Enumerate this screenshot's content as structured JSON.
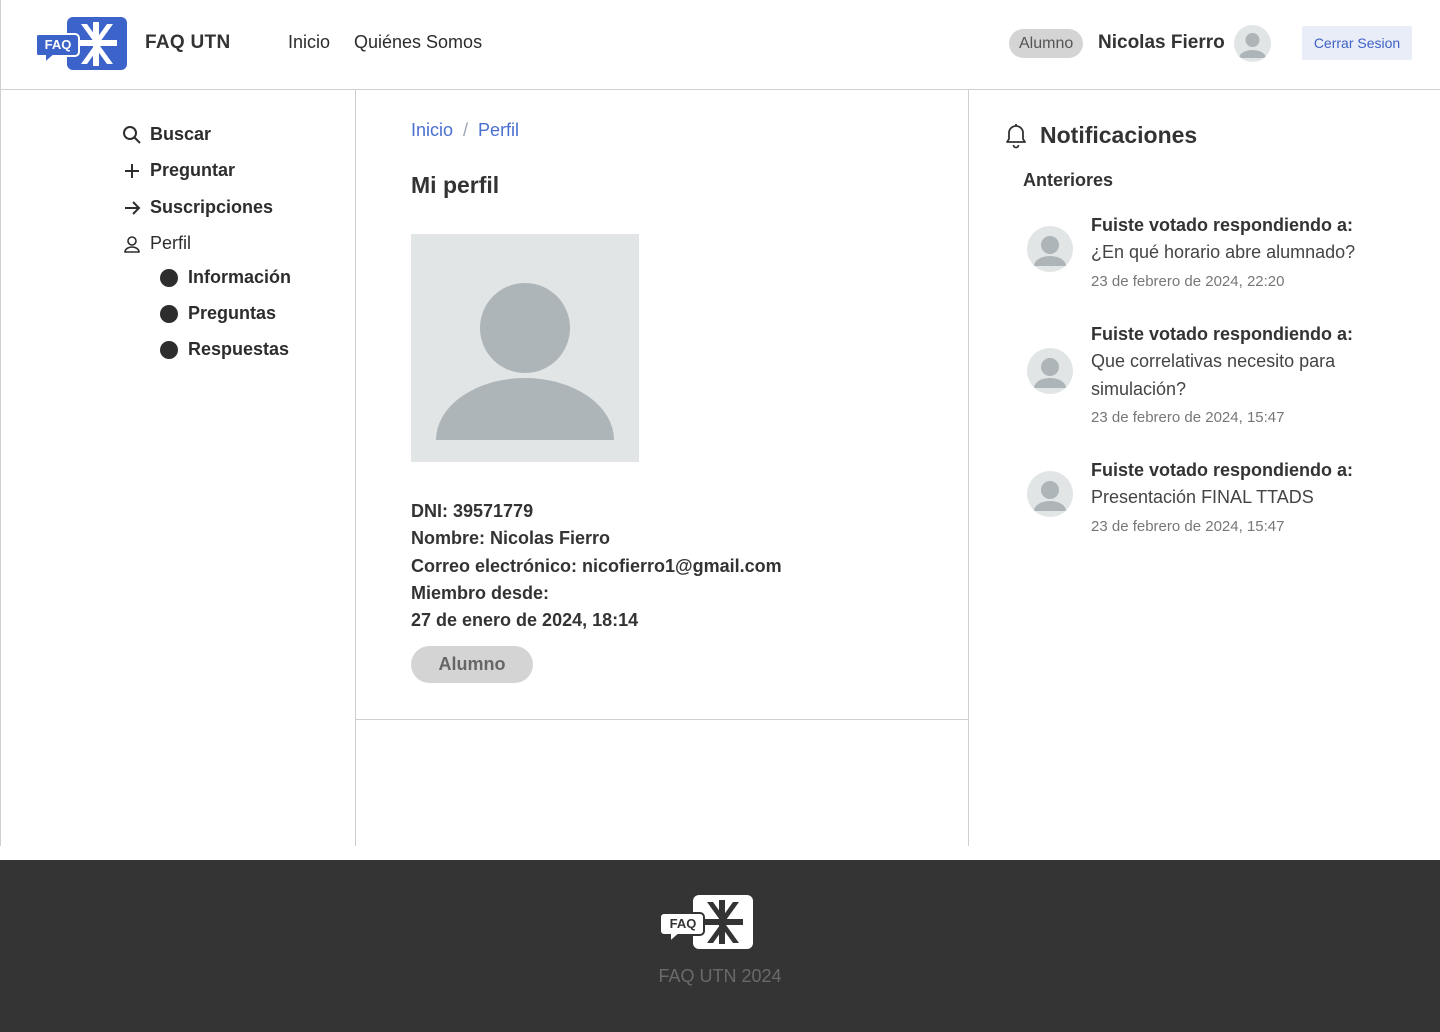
{
  "header": {
    "logo_text": "FAQ",
    "brand": "FAQ UTN",
    "nav": [
      "Inicio",
      "Quiénes Somos"
    ],
    "role": "Alumno",
    "user_name": "Nicolas Fierro",
    "logout_label": "Cerrar Sesion"
  },
  "sidebar": {
    "items": [
      {
        "label": "Buscar",
        "icon": "search-icon"
      },
      {
        "label": "Preguntar",
        "icon": "plus-icon"
      },
      {
        "label": "Suscripciones",
        "icon": "arrow-right-icon"
      },
      {
        "label": "Perfil",
        "icon": "user-icon"
      }
    ],
    "subitems": [
      "Información",
      "Preguntas",
      "Respuestas"
    ]
  },
  "main": {
    "breadcrumb": [
      "Inicio",
      "Perfil"
    ],
    "breadcrumb_sep": "/",
    "title": "Mi perfil",
    "info": {
      "dni": "DNI: 39571779",
      "nombre": "Nombre: Nicolas Fierro",
      "correo": "Correo electrónico: nicofierro1@gmail.com",
      "miembro_label": "Miembro desde:",
      "miembro_fecha": "27 de enero de 2024, 18:14"
    },
    "role_badge": "Alumno"
  },
  "notifications": {
    "title": "Notificaciones",
    "section": "Anteriores",
    "items": [
      {
        "title": "Fuiste votado respondiendo a:",
        "text": "¿En qué horario abre alumnado?",
        "date": "23 de febrero de 2024, 22:20"
      },
      {
        "title": "Fuiste votado respondiendo a:",
        "text": "Que correlativas necesito para simulación?",
        "date": "23 de febrero de 2024, 15:47"
      },
      {
        "title": "Fuiste votado respondiendo a:",
        "text": "Presentación FINAL TTADS",
        "date": "23 de febrero de 2024, 15:47"
      }
    ]
  },
  "footer": {
    "logo_text": "FAQ",
    "text": "FAQ UTN 2024"
  },
  "colors": {
    "accent": "#3f62c6",
    "link": "#4a6fd0",
    "footer_bg": "#343434",
    "placeholder_bg": "#e1e5e6",
    "placeholder_fg": "#adb5b8"
  }
}
